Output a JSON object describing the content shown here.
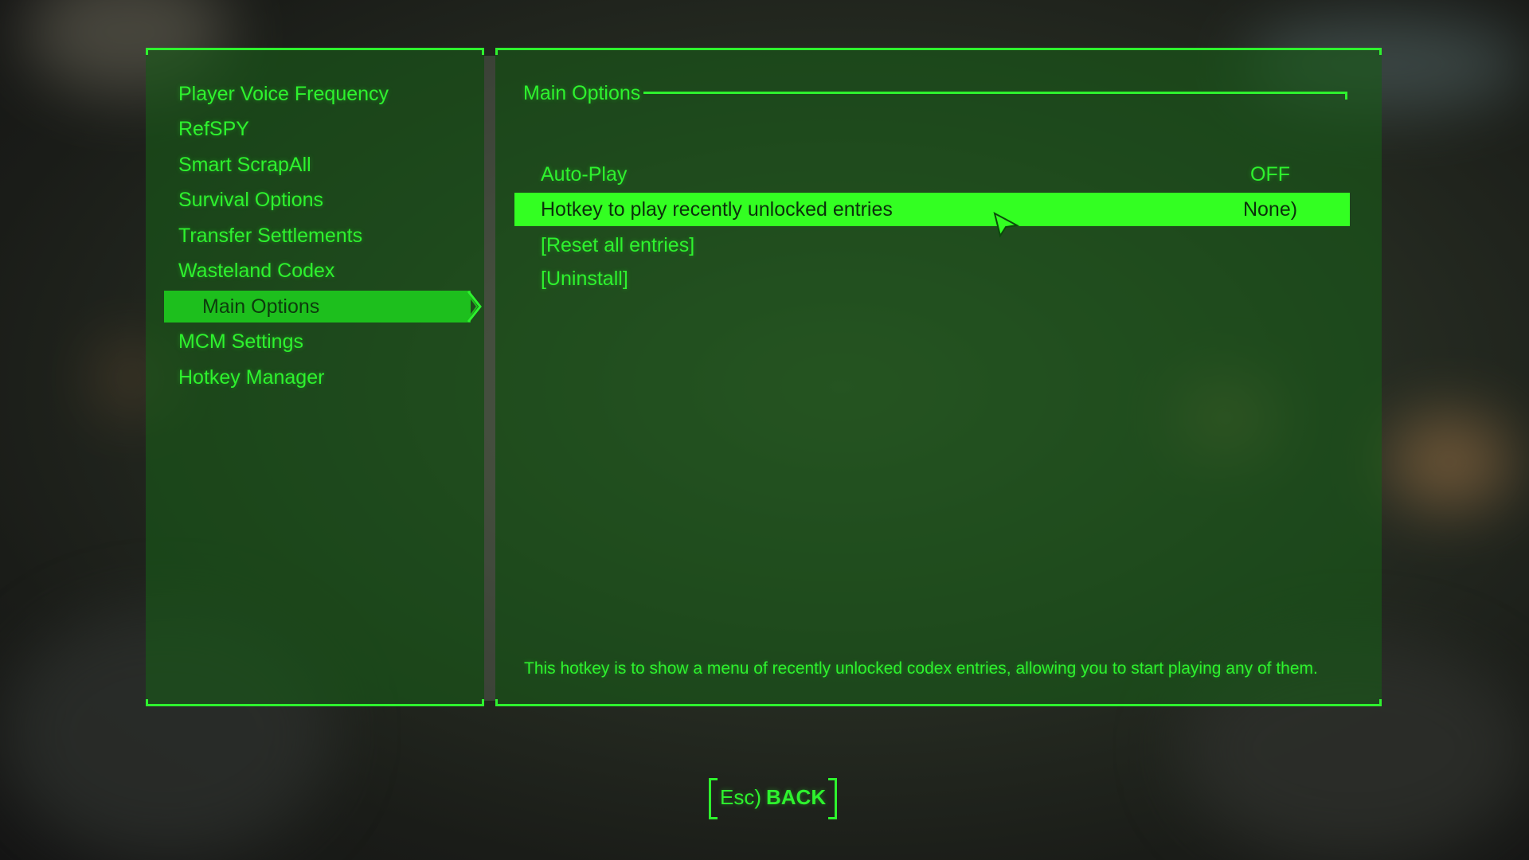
{
  "left_menu": {
    "items": [
      "Player Voice Frequency",
      "RefSPY",
      "Smart ScrapAll",
      "Survival Options",
      "Transfer Settlements",
      "Wasteland Codex",
      "Main Options",
      "MCM Settings",
      "Hotkey Manager"
    ],
    "selected": "Main Options"
  },
  "right_panel": {
    "section_title": "Main Options",
    "options": [
      {
        "label": "Auto-Play",
        "value": "OFF"
      },
      {
        "label": "Hotkey to play recently unlocked entries",
        "value": "None)"
      },
      {
        "label": "[Reset all entries]",
        "value": ""
      },
      {
        "label": "[Uninstall]",
        "value": ""
      }
    ],
    "highlighted_option": "Hotkey to play recently unlocked entries",
    "description": "This hotkey is to show a menu of recently unlocked codex entries, allowing you to start playing any of them."
  },
  "footer": {
    "back_key": "Esc)",
    "back_label": "BACK"
  },
  "colors": {
    "accent": "#2ef22e",
    "selected_bg": "#1dbf1d",
    "highlight_bg": "#33ff22",
    "panel_bg": "#185a18"
  },
  "icons": {
    "selection": "chevron-right-icon",
    "pointer": "mouse-cursor-icon"
  }
}
